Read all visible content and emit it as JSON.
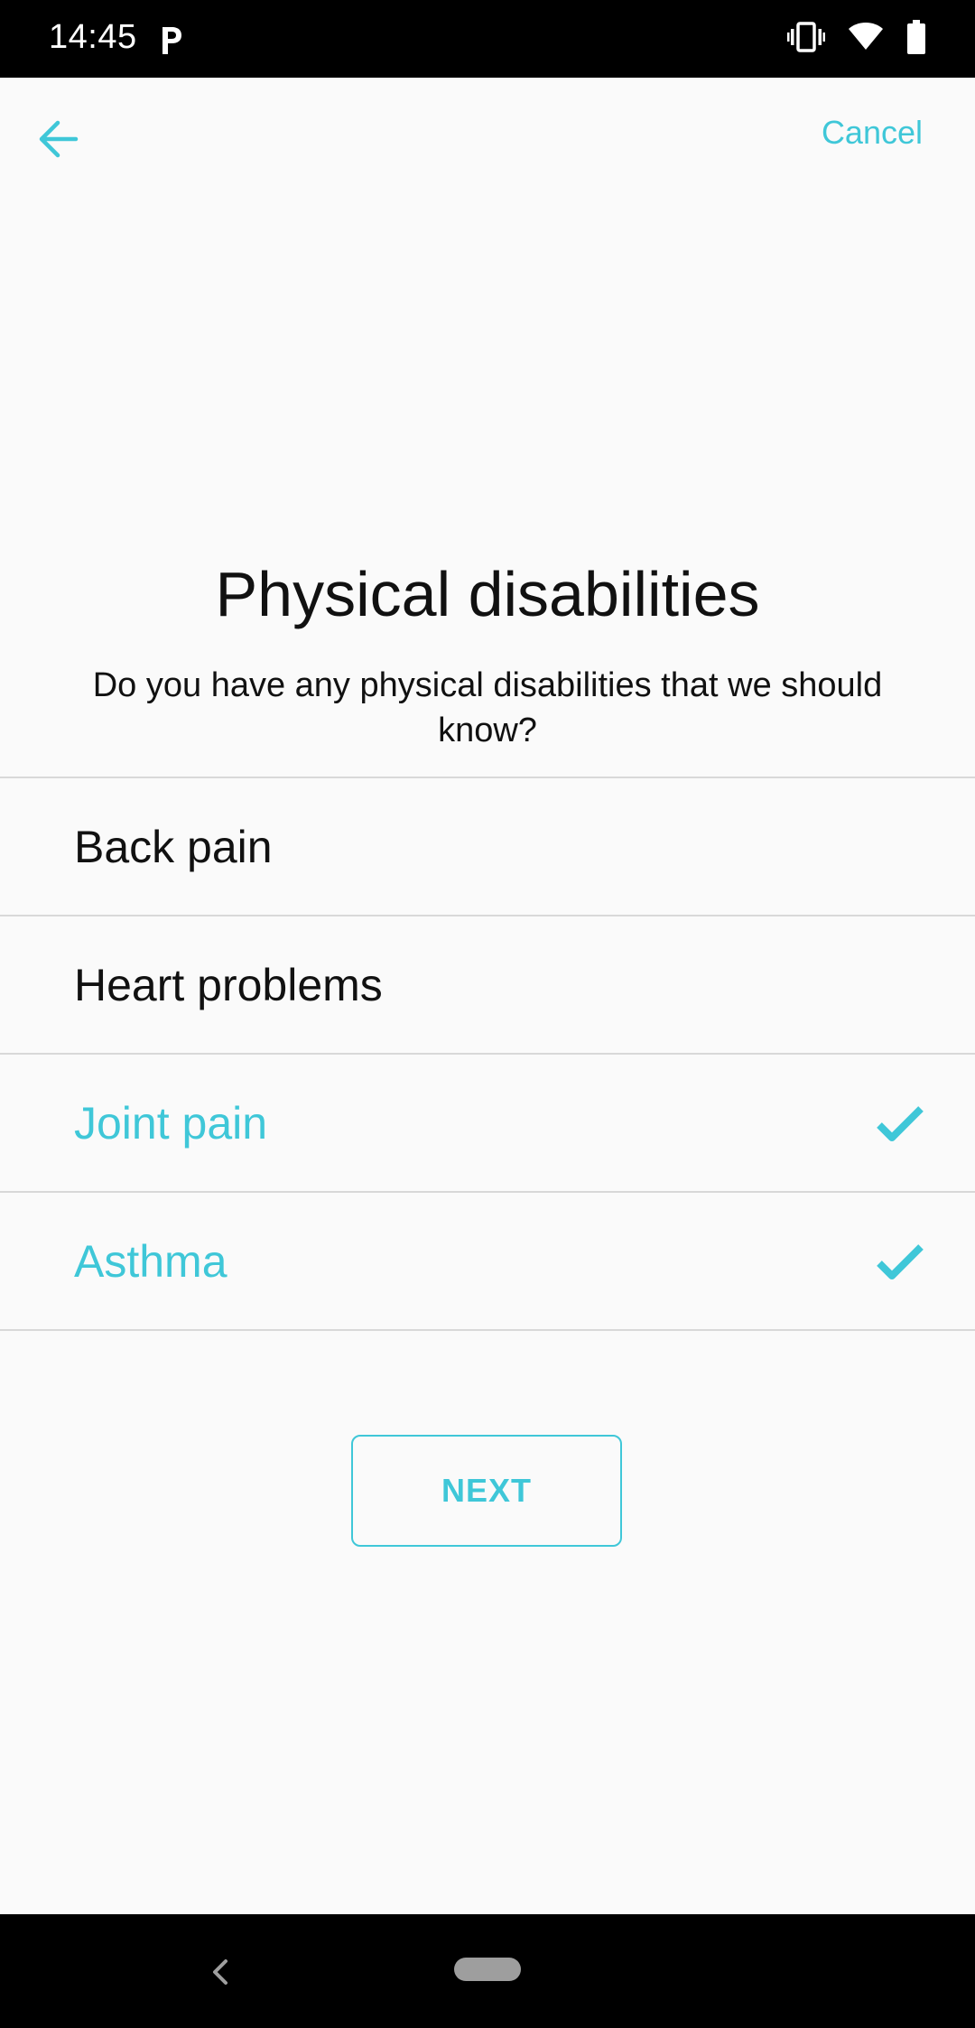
{
  "status_bar": {
    "time": "14:45",
    "icons": [
      "parking-app-icon",
      "vibrate-icon",
      "wifi-icon",
      "battery-icon"
    ]
  },
  "toolbar": {
    "back_icon": "arrow-left-icon",
    "cancel_label": "Cancel"
  },
  "main": {
    "title": "Physical disabilities",
    "subtitle": "Do you have any physical disabilities that we should know?"
  },
  "options": [
    {
      "label": "Back pain",
      "selected": false
    },
    {
      "label": "Heart problems",
      "selected": false
    },
    {
      "label": "Joint pain",
      "selected": true
    },
    {
      "label": "Asthma",
      "selected": true
    }
  ],
  "actions": {
    "next_label": "NEXT"
  },
  "nav_bar": {
    "icons": [
      "nav-back-icon",
      "home-pill-icon"
    ]
  },
  "colors": {
    "accent": "#3fc7d8",
    "text": "#111111",
    "background": "#fafafa",
    "divider": "#d8d8d8"
  }
}
